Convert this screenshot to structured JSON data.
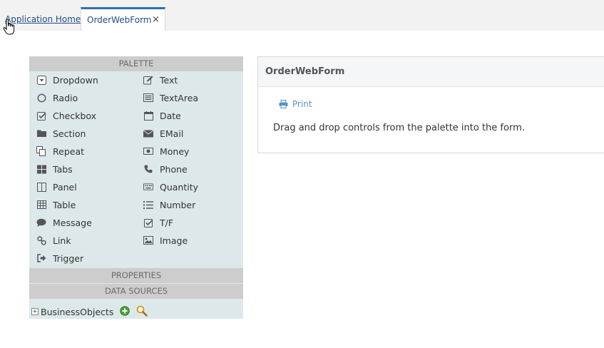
{
  "tabs": {
    "home_label": "Application Home",
    "active_label": "OrderWebForm",
    "close_symbol": "×"
  },
  "palette": {
    "header": "PALETTE",
    "left": [
      "Dropdown",
      "Radio",
      "Checkbox",
      "Section",
      "Repeat",
      "Tabs",
      "Panel",
      "Table",
      "Message",
      "Link",
      "Trigger"
    ],
    "right": [
      "Text",
      "TextArea",
      "Date",
      "EMail",
      "Money",
      "Phone",
      "Quantity",
      "Number",
      "T/F",
      "Image"
    ]
  },
  "properties_header": "PROPERTIES",
  "data_sources": {
    "header": "DATA SOURCES",
    "tree_root": "BusinessObjects",
    "expander": "+"
  },
  "form": {
    "title": "OrderWebForm",
    "print_label": "Print",
    "hint": "Drag and drop controls from the palette into the form."
  },
  "colors": {
    "tab_accent": "#2f6db5",
    "palette_bg": "#dde8ea",
    "header_bg": "#cdcdcd",
    "link": "#1f4e86",
    "print_link": "#5a8fc8"
  }
}
